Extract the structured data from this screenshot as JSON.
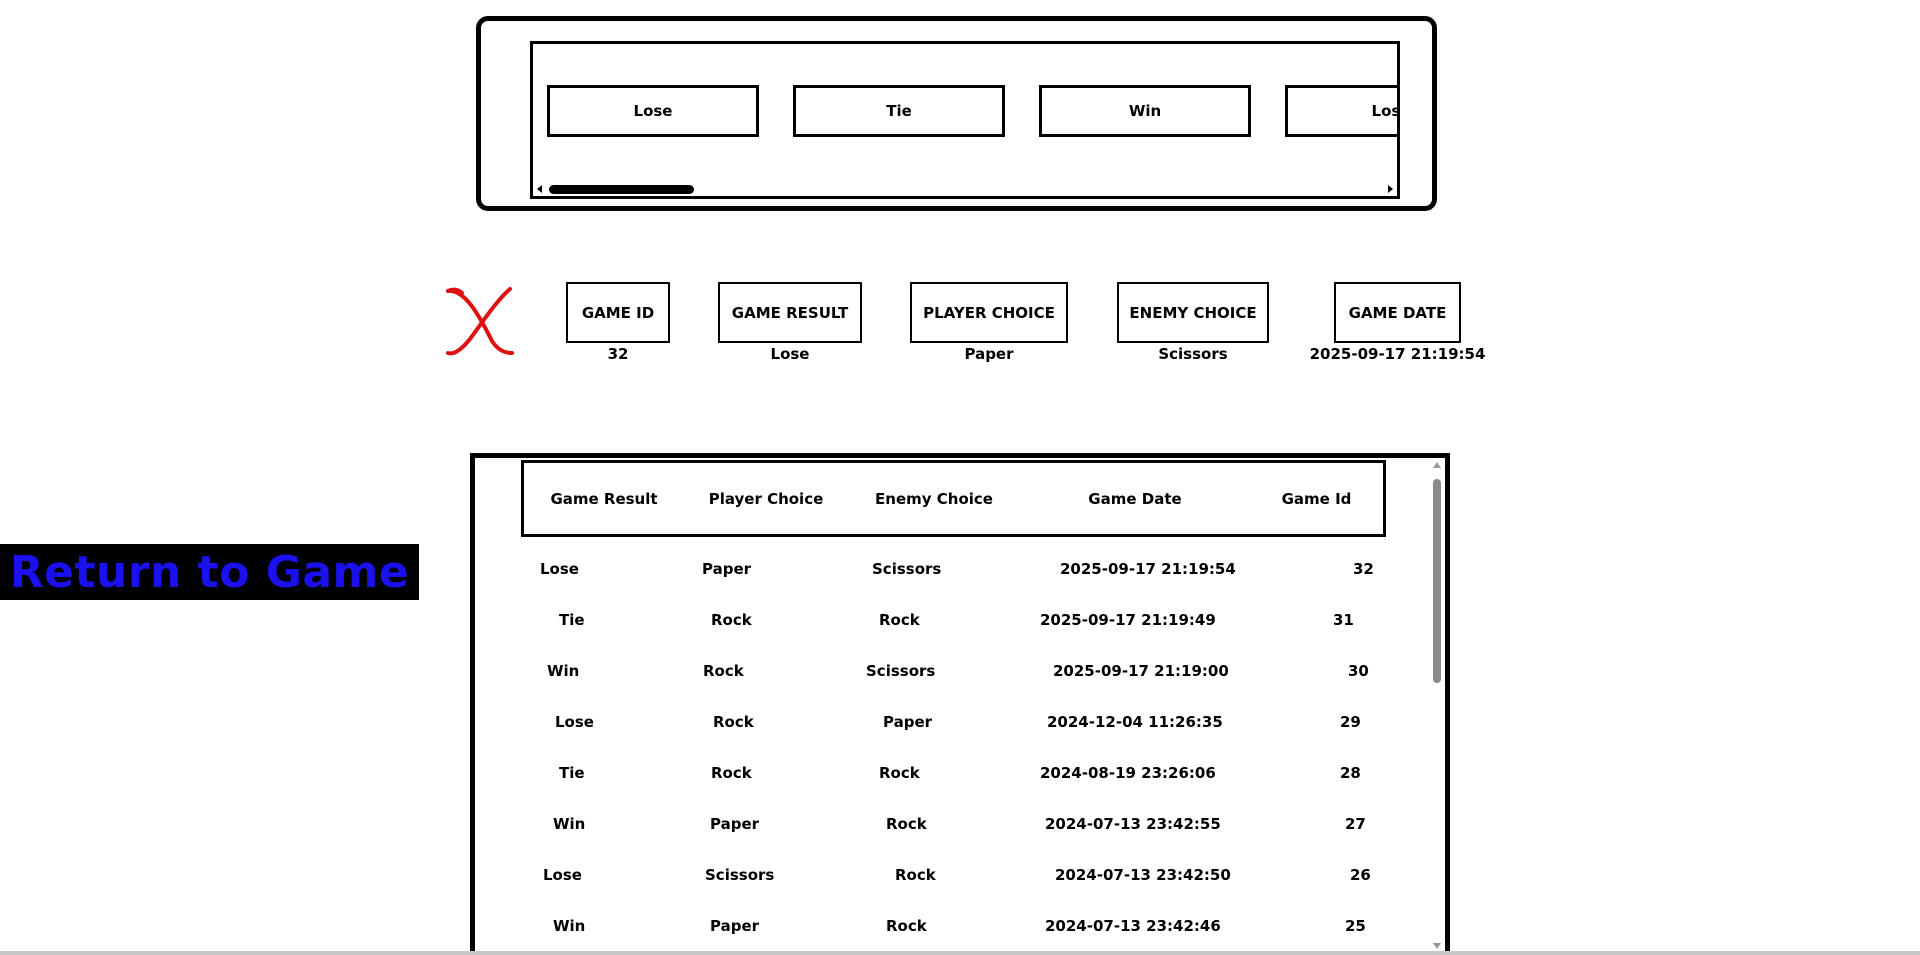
{
  "carousel": {
    "cards": [
      "Lose",
      "Tie",
      "Win",
      "Lose"
    ]
  },
  "detail": {
    "headers": {
      "game_id": "GAME ID",
      "game_result": "GAME RESULT",
      "player_choice": "PLAYER CHOICE",
      "enemy_choice": "ENEMY CHOICE",
      "game_date": "GAME DATE"
    },
    "values": {
      "game_id": "32",
      "game_result": "Lose",
      "player_choice": "Paper",
      "enemy_choice": "Scissors",
      "game_date": "2025-09-17 21:19:54"
    },
    "close_icon_color": "#e01010"
  },
  "return_button": {
    "label": "Return to Game",
    "text_color": "#1a10f0",
    "background": "#000000"
  },
  "history_table": {
    "columns": [
      "Game Result",
      "Player Choice",
      "Enemy Choice",
      "Game Date",
      "Game Id"
    ],
    "rows": [
      [
        "Lose",
        "Paper",
        "Scissors",
        "2025-09-17 21:19:54",
        "32"
      ],
      [
        "Tie",
        "Rock",
        "Rock",
        "2025-09-17 21:19:49",
        "31"
      ],
      [
        "Win",
        "Rock",
        "Scissors",
        "2025-09-17 21:19:00",
        "30"
      ],
      [
        "Lose",
        "Rock",
        "Paper",
        "2024-12-04 11:26:35",
        "29"
      ],
      [
        "Tie",
        "Rock",
        "Rock",
        "2024-08-19 23:26:06",
        "28"
      ],
      [
        "Win",
        "Paper",
        "Rock",
        "2024-07-13 23:42:55",
        "27"
      ],
      [
        "Lose",
        "Scissors",
        "Rock",
        "2024-07-13 23:42:50",
        "26"
      ],
      [
        "Win",
        "Paper",
        "Rock",
        "2024-07-13 23:42:46",
        "25"
      ]
    ]
  }
}
